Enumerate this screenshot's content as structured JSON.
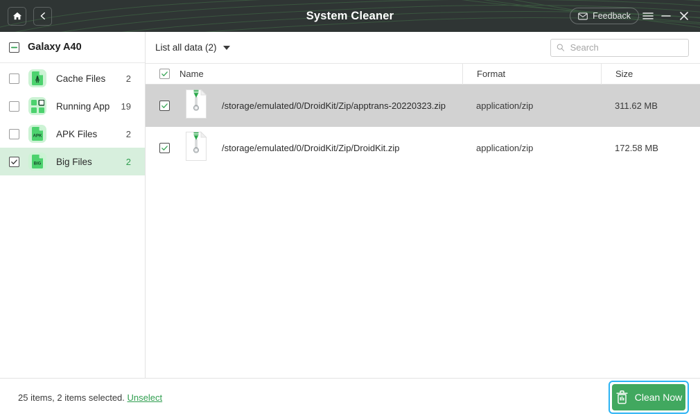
{
  "window": {
    "title": "System Cleaner",
    "home_icon": "home-icon",
    "back_icon": "back-chevron-icon",
    "feedback_label": "Feedback",
    "feedback_icon": "envelope-icon",
    "menu_icon": "hamburger-menu-icon",
    "minimize_icon": "minimize-icon",
    "close_icon": "close-icon",
    "titlebar_bg": "#2f3534",
    "accent_green": "#41a85f",
    "focus_blue": "#2bb3f3"
  },
  "sidebar": {
    "device": {
      "name": "Galaxy A40",
      "checkbox_state": "indeterminate"
    },
    "items": [
      {
        "label": "Cache Files",
        "count": "2",
        "icon": "cache-file-icon",
        "checked": false,
        "selected": false
      },
      {
        "label": "Running App",
        "count": "19",
        "icon": "running-app-icon",
        "checked": false,
        "selected": false
      },
      {
        "label": "APK Files",
        "count": "2",
        "icon": "apk-file-icon",
        "checked": false,
        "selected": false
      },
      {
        "label": "Big Files",
        "count": "2",
        "icon": "big-file-icon",
        "checked": true,
        "selected": true
      }
    ]
  },
  "toolbar": {
    "filter_label": "List all data (2)",
    "filter_caret_icon": "chevron-down-icon",
    "search_placeholder": "Search",
    "search_value": "",
    "search_icon": "search-icon"
  },
  "table": {
    "columns": [
      "Name",
      "Format",
      "Size"
    ],
    "header_checkbox_checked": true,
    "rows": [
      {
        "checked": true,
        "icon": "zip-file-icon",
        "name": "/storage/emulated/0/DroidKit/Zip/apptrans-20220323.zip",
        "format": "application/zip",
        "size": "311.62 MB",
        "active": true
      },
      {
        "checked": true,
        "icon": "zip-file-icon",
        "name": "/storage/emulated/0/DroidKit/Zip/DroidKit.zip",
        "format": "application/zip",
        "size": "172.58 MB",
        "active": false
      }
    ]
  },
  "footer": {
    "status_prefix": "25 items, 2 items selected.",
    "unselect_label": "Unselect",
    "clean_label": "Clean Now",
    "clean_icon": "trash-can-icon"
  }
}
